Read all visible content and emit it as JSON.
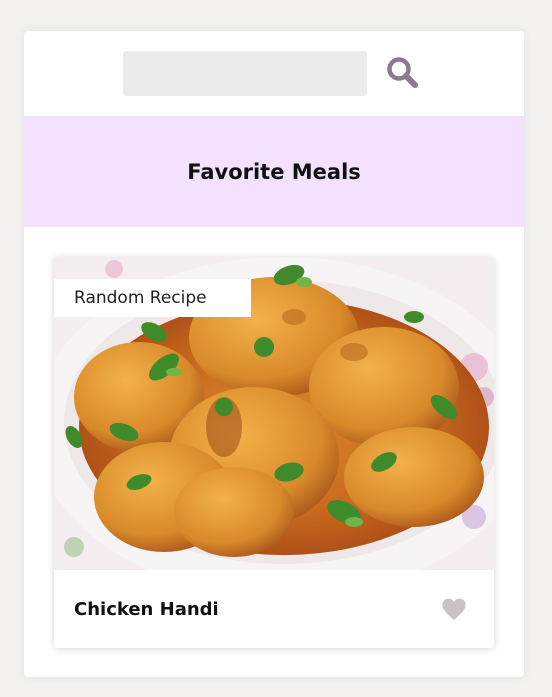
{
  "search": {
    "value": "",
    "placeholder": "",
    "button_icon": "search-icon",
    "icon_color": "#8a7a8c"
  },
  "favorites": {
    "title": "Favorite Meals",
    "bar_color": "#f3e1ff"
  },
  "meal": {
    "badge": "Random Recipe",
    "name": "Chicken Handi",
    "favorite_icon": "heart-icon",
    "favorite_active": false,
    "heart_color": "#c9c4c4"
  }
}
